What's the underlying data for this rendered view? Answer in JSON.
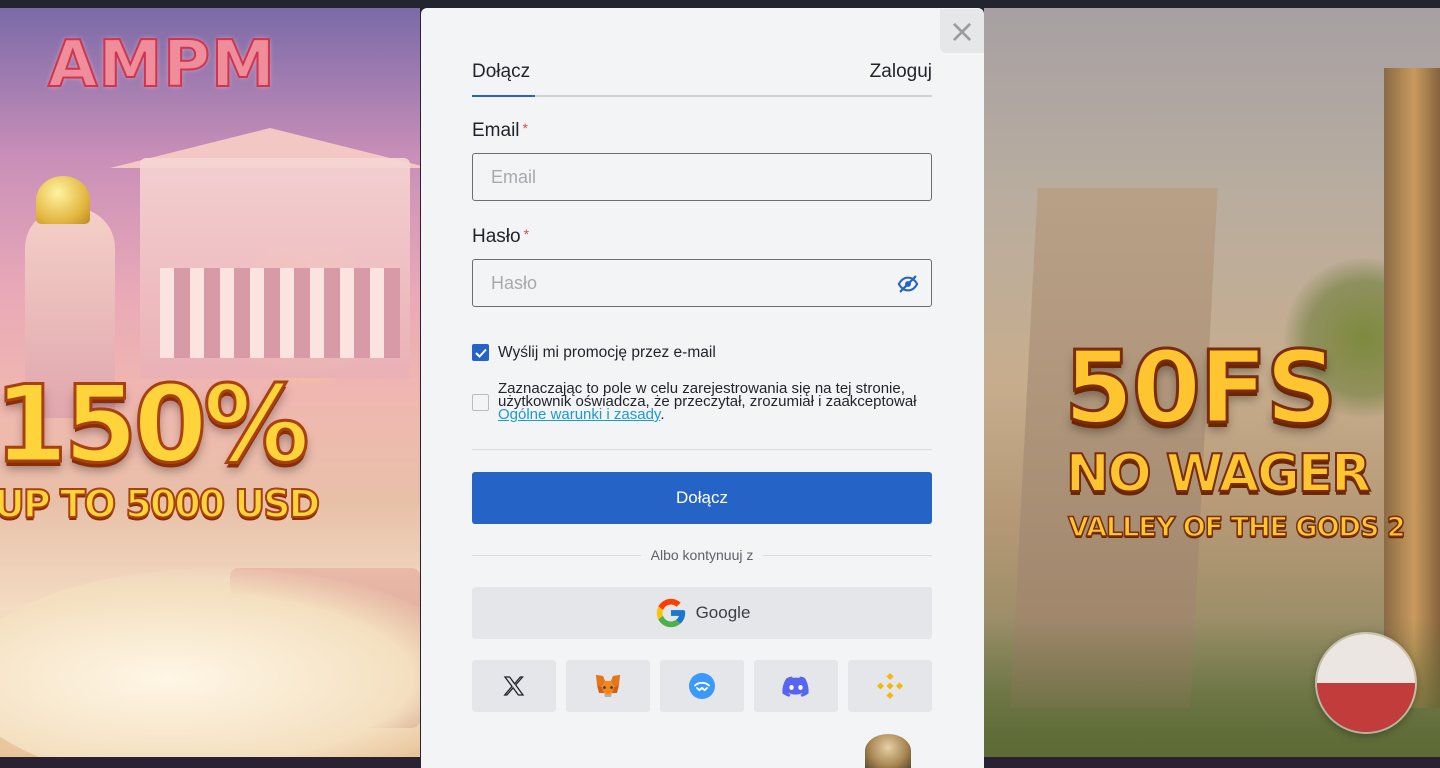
{
  "left_promo": {
    "brand": "AMPM",
    "headline": "150%",
    "subline": "UP TO 5000 USD"
  },
  "right_promo": {
    "headline": "50FS",
    "subline": "NO WAGER",
    "game": "VALLEY OF THE GODS 2"
  },
  "modal": {
    "close_icon": "×",
    "tabs": [
      {
        "label": "Dołącz",
        "active": true
      },
      {
        "label": "Zaloguj",
        "active": false
      }
    ],
    "email": {
      "label": "Email",
      "required_mark": "*",
      "placeholder": "Email",
      "value": ""
    },
    "password": {
      "label": "Hasło",
      "required_mark": "*",
      "placeholder": "Hasło",
      "value": "",
      "toggle_icon": "eye-slash-icon"
    },
    "promo_checkbox": {
      "label": "Wyślij mi promocję przez e-mail",
      "checked": true
    },
    "terms_checkbox": {
      "text": "Zaznaczając to pole w celu zarejestrowania się na tej stronie, użytkownik oświadcza, że przeczytał, zrozumiał i zaakceptował ",
      "link": "Ogólne warunki i zasady",
      "suffix": ".",
      "checked": false
    },
    "submit_label": "Dołącz",
    "or_text": "Albo kontynuuj z",
    "google_label": "Google",
    "social_icons": [
      "x-icon",
      "metamask-icon",
      "walletconnect-icon",
      "discord-icon",
      "binance-icon"
    ]
  },
  "colors": {
    "accent": "#2563c7",
    "link": "#1a9ad6",
    "required": "#e24a4a",
    "modal_bg": "#f3f4f5"
  }
}
